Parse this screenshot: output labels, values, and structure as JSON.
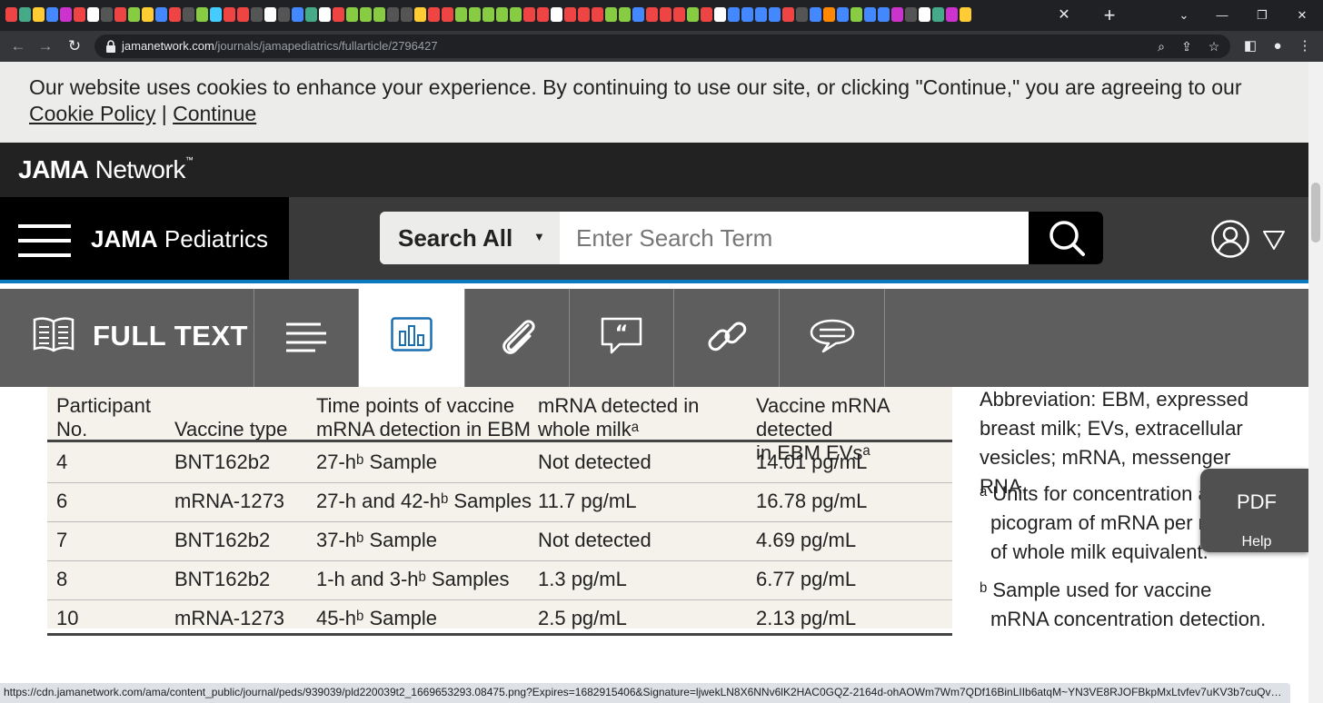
{
  "browser": {
    "favicon_colors": [
      "#e44",
      "#4a8",
      "#fc3",
      "#48f",
      "#c3c",
      "#e44",
      "#fff",
      "#555",
      "#e44",
      "#8c4",
      "#fc3",
      "#48f",
      "#e44",
      "#555",
      "#8c4",
      "#4cf",
      "#e44",
      "#e44",
      "#555",
      "#fff",
      "#555",
      "#48f",
      "#4a8",
      "#fff",
      "#e44",
      "#8c4",
      "#8c4",
      "#8c4",
      "#555",
      "#555",
      "#fc3",
      "#e44",
      "#e44",
      "#8c4",
      "#8c4",
      "#8c4",
      "#8c4",
      "#8c4",
      "#e44",
      "#e44",
      "#fff",
      "#e44",
      "#e44",
      "#e44",
      "#8c4",
      "#8c4",
      "#48f",
      "#e44",
      "#e44",
      "#e44",
      "#8c4",
      "#e44",
      "#fff",
      "#48f",
      "#48f",
      "#48f",
      "#48f",
      "#e44",
      "#555",
      "#48f",
      "#f80",
      "#48f",
      "#8c4",
      "#48f",
      "#48f",
      "#c3c",
      "#555",
      "#fff",
      "#4a8",
      "#c3c",
      "#fc3"
    ],
    "new_tab": "+",
    "tab_close": "✕",
    "window_controls": [
      "⌄",
      "—",
      "❐",
      "✕"
    ],
    "url_host": "jamanetwork.com",
    "url_path": "/journals/jamapediatrics/fullarticle/2796427",
    "status_url": "https://cdn.jamanetwork.com/ama/content_public/journal/peds/939039/pld220039t2_1669653293.08475.png?Expires=1682915406&Signature=ljwekLN8X6NNv6lK2HAC0GQZ-2164d-ohAOWm7Wm7QDf16BinLIIb6atqM~YN3VE8RJOFBkpMxLtvfev7uKV3b7cuQvVOzEUtHyGNULtNZ..."
  },
  "cookie_banner": {
    "text": "Our website uses cookies to enhance your experience. By continuing to use our site, or clicking \"Continue,\" you are agreeing to our",
    "policy_link": "Cookie Policy",
    "separator": " | ",
    "continue_link": "Continue"
  },
  "brand": {
    "bold": "JAMA",
    "rest": " Network",
    "tm": "™"
  },
  "header": {
    "journal_bold": "JAMA",
    "journal_rest": " Pediatrics",
    "search_scope": "Search All",
    "search_caret": "▼",
    "search_placeholder": "Enter Search Term"
  },
  "article_tabs": {
    "full_text_label": "FULL TEXT",
    "active_index": 2
  },
  "table": {
    "headers": [
      {
        "line1": "Participant",
        "line2": "No."
      },
      {
        "line1": "",
        "line2": "Vaccine type"
      },
      {
        "line1": "Time points of vaccine",
        "line2": "mRNA detection in EBM"
      },
      {
        "line1": "mRNA detected in",
        "line2": "whole milkᵃ"
      },
      {
        "line1": "Vaccine mRNA detected",
        "line2": "in EBM EVsᵃ"
      }
    ],
    "rows": [
      [
        "4",
        "BNT162b2",
        "27-hᵇ Sample",
        "Not detected",
        "14.01 pg/mL"
      ],
      [
        "6",
        "mRNA-1273",
        "27-h and 42-hᵇ Samples",
        "11.7 pg/mL",
        "16.78 pg/mL"
      ],
      [
        "7",
        "BNT162b2",
        "37-hᵇ Sample",
        "Not detected",
        "4.69 pg/mL"
      ],
      [
        "8",
        "BNT162b2",
        "1-h and 3-hᵇ Samples",
        "1.3 pg/mL",
        "6.77 pg/mL"
      ],
      [
        "10",
        "mRNA-1273",
        "45-hᵇ Sample",
        "2.5 pg/mL",
        "2.13 pg/mL"
      ]
    ]
  },
  "footnotes": {
    "abbrev": "Abbreviation: EBM, expressed breast milk; EVs, extracellular vesicles; mRNA, messenger RNA.",
    "note_a": "ᵃ Units for concentration are picogram of mRNA per milliliter of whole milk equivalent.",
    "note_b": "ᵇ Sample used for vaccine mRNA concentration detection."
  },
  "pdf_widget": {
    "pdf_label": "PDF",
    "help_label": "Help"
  }
}
